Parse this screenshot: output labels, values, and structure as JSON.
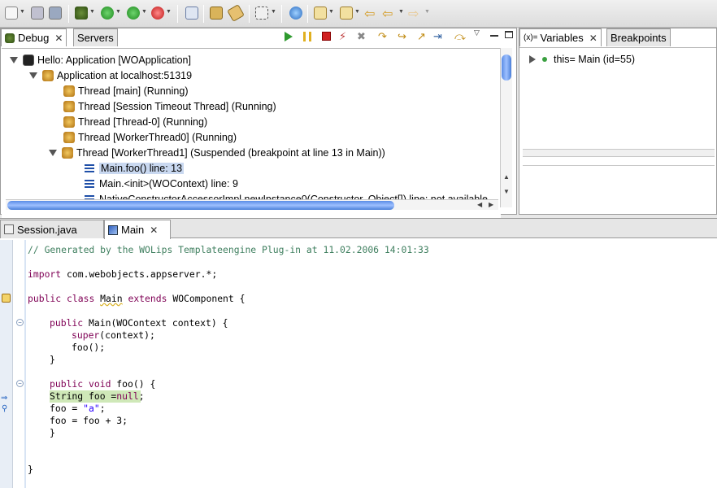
{
  "views": {
    "debug_tab": "Debug",
    "servers_tab": "Servers",
    "variables_tab": "Variables",
    "breakpoints_tab": "Breakpoints",
    "variables_icon_text": "(x)="
  },
  "debug_tree": {
    "launch": "Hello: Application [WOApplication]",
    "target": "Application at localhost:51319",
    "threads": [
      "Thread [main] (Running)",
      "Thread [Session Timeout Thread] (Running)",
      "Thread [Thread-0] (Running)",
      "Thread [WorkerThread0] (Running)",
      "Thread [WorkerThread1] (Suspended (breakpoint at line 13 in Main))"
    ],
    "frames": [
      "Main.foo() line: 13",
      "Main.<init>(WOContext) line: 9",
      "NativeConstructorAccessorImpl.newInstance0(Constructor, Object[]) line: not available"
    ]
  },
  "variables": {
    "rows": [
      {
        "name": "this",
        "value": "Main  (id=55)"
      }
    ]
  },
  "editor": {
    "tabs": [
      {
        "label": "Session.java"
      },
      {
        "label": "Main"
      }
    ],
    "lines": {
      "l1": "// Generated by the WOLips Templateengine Plug-in at 11.02.2006 14:01:33",
      "l3a": "import",
      "l3b": " com.webobjects.appserver.*;",
      "l5a": "public",
      "l5b": "class",
      "l5c": "Main",
      "l5d": "extends",
      "l5e": " WOComponent {",
      "l7a": "public",
      "l7b": " Main(WOContext context) {",
      "l8a": "super",
      "l8b": "(context);",
      "l9": "foo();",
      "l10": "}",
      "l12a": "public",
      "l12b": "void",
      "l12c": " foo() {",
      "l13a": "String foo =",
      "l13b": "null",
      "l13c": ";",
      "l14a": "foo = ",
      "l14b": "\"a\"",
      "l14c": ";",
      "l15": "foo = foo + 3;",
      "l16": "}",
      "l19": "}"
    }
  },
  "colors": {
    "keyword": "#7f0055",
    "comment": "#3f7f5f",
    "string": "#2a00ff",
    "current_line": "#cfe8b8",
    "selection": "#c9d8f0"
  }
}
